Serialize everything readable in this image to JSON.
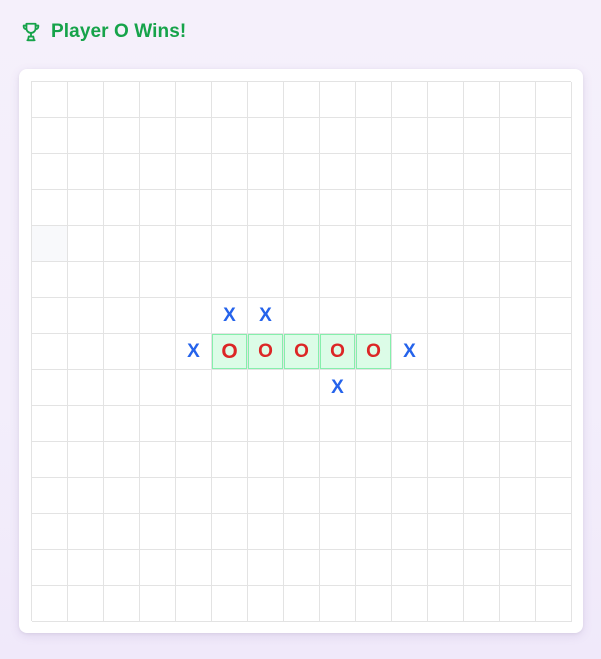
{
  "status": {
    "icon": "trophy-icon",
    "message": "Player O Wins!",
    "color": "#16a34a"
  },
  "board": {
    "size": 15,
    "colors": {
      "x": "#2563eb",
      "o": "#dc2626",
      "win_bg": "#dcfce7",
      "win_border": "#86efac",
      "grid_line": "#e3e3e3"
    },
    "hover_cell": {
      "row": 4,
      "col": 0
    },
    "last_move": {
      "row": 7,
      "col": 5
    },
    "winning_line": [
      [
        7,
        5
      ],
      [
        7,
        6
      ],
      [
        7,
        7
      ],
      [
        7,
        8
      ],
      [
        7,
        9
      ]
    ],
    "pieces": [
      {
        "row": 6,
        "col": 5,
        "mark": "X"
      },
      {
        "row": 6,
        "col": 6,
        "mark": "X"
      },
      {
        "row": 7,
        "col": 4,
        "mark": "X"
      },
      {
        "row": 7,
        "col": 5,
        "mark": "O"
      },
      {
        "row": 7,
        "col": 6,
        "mark": "O"
      },
      {
        "row": 7,
        "col": 7,
        "mark": "O"
      },
      {
        "row": 7,
        "col": 8,
        "mark": "O"
      },
      {
        "row": 7,
        "col": 9,
        "mark": "O"
      },
      {
        "row": 7,
        "col": 10,
        "mark": "X"
      },
      {
        "row": 8,
        "col": 8,
        "mark": "X"
      }
    ]
  }
}
